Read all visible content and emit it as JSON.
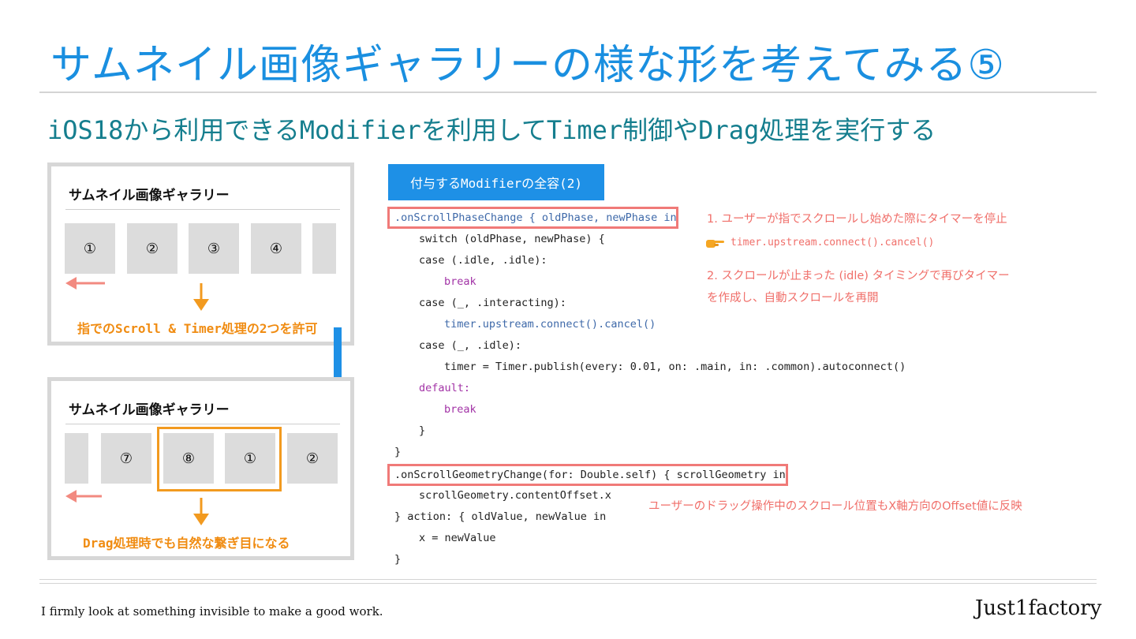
{
  "title": "サムネイル画像ギャラリーの様な形を考えてみる⑤",
  "subtitle": "iOS18から利用できるModifierを利用してTimer制御やDrag処理を実行する",
  "panel_top": {
    "title": "サムネイル画像ギャラリー",
    "thumbs": [
      "①",
      "②",
      "③",
      "④",
      ""
    ],
    "caption": "指でのScroll & Timer処理の2つを許可"
  },
  "panel_bottom": {
    "title": "サムネイル画像ギャラリー",
    "thumbs": [
      "",
      "⑦",
      "⑧",
      "①",
      "②"
    ],
    "caption": "Drag処理時でも自然な繋ぎ目になる"
  },
  "tab_label": "付与するModifierの全容(2)",
  "code_lines": [
    ".onScrollPhaseChange { oldPhase, newPhase in",
    "switch (oldPhase, newPhase) {",
    "case (.idle, .idle):",
    "break",
    "case (_, .interacting):",
    "timer.upstream.connect().cancel()",
    "case (_, .idle):",
    "timer = Timer.publish(every: 0.01, on: .main, in: .common).autoconnect()",
    "default:",
    "break",
    "}",
    "}",
    ".onScrollGeometryChange(for: Double.self) { scrollGeometry in",
    "scrollGeometry.contentOffset.x",
    "} action: { oldValue, newValue in",
    "x = newValue",
    "}"
  ],
  "notes": {
    "note1": "1. ユーザーが指でスクロールし始めた際にタイマーを停止",
    "note1_code": "timer.upstream.connect().cancel()",
    "note1_icon": "pointing-hand-icon",
    "note2_line1": "2. スクロールが止まった (idle) タイミングで再びタイマー",
    "note2_line2": "を作成し、自動スクロールを再開",
    "note3": "ユーザーのドラッグ操作中のスクロール位置もX軸方向のOffset値に反映"
  },
  "colors": {
    "title": "#1a8fe0",
    "subtitle": "#157e8e",
    "accent_orange": "#f29a1f",
    "arrow_blue": "#1e90e6",
    "arrow_salmon": "#f28a80",
    "note_red": "#f06f6a"
  },
  "footer": {
    "left": "I firmly look at something invisible to make a good work.",
    "right": "Just1factory"
  }
}
